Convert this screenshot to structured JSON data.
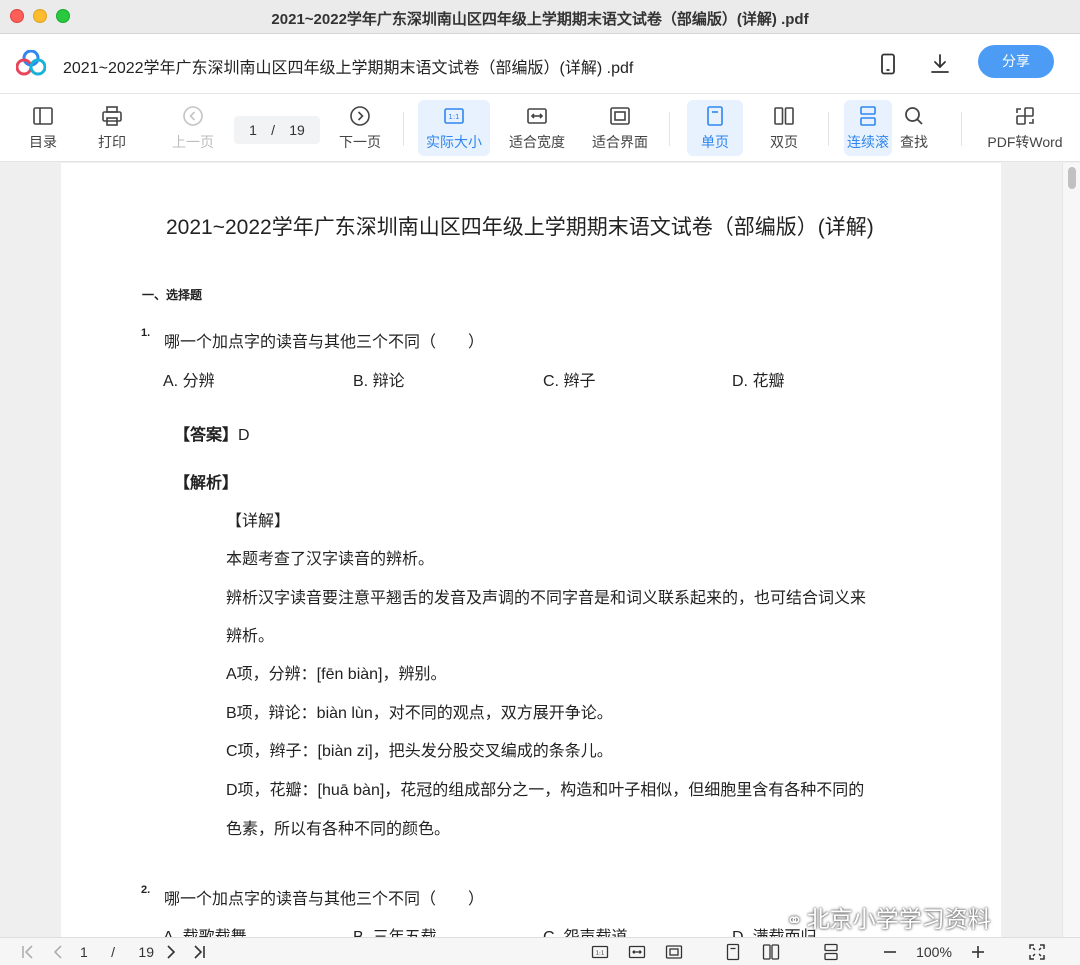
{
  "window": {
    "title": "2021~2022学年广东深圳南山区四年级上学期期末语文试卷（部编版）(详解) .pdf"
  },
  "appbar": {
    "doc_title": "2021~2022学年广东深圳南山区四年级上学期期末语文试卷（部编版）(详解) .pdf",
    "share_label": "分享",
    "icons": [
      "logo-icon",
      "phone-icon",
      "download-icon"
    ]
  },
  "toolbar": {
    "toc": "目录",
    "print": "打印",
    "prev": "上一页",
    "page_current": "1",
    "page_sep": "/",
    "page_total": "19",
    "next": "下一页",
    "actual_size": "实际大小",
    "fit_width": "适合宽度",
    "fit_page": "适合界面",
    "single": "单页",
    "double": "双页",
    "continuous": "连续滚",
    "find": "查找",
    "pdf_to_word": "PDF转Word",
    "accent_color": "#2f86ee"
  },
  "document": {
    "title": "2021~2022学年广东深圳南山区四年级上学期期末语文试卷（部编版）(详解)",
    "section": "一、选择题",
    "q1": {
      "num": "1.",
      "text": "哪一个加点字的读音与其他三个不同（　　）",
      "options": [
        "A. 分辨",
        "B. 辩论",
        "C. 辫子",
        "D. 花瓣"
      ],
      "answer_label": "【答案】",
      "answer": "D",
      "analysis_label": "【解析】",
      "detail_label": "【详解】",
      "lines": [
        "本题考查了汉字读音的辨析。",
        "辨析汉字读音要注意平翘舌的发音及声调的不同字音是和词义联系起来的，也可结合词义来",
        "辨析。",
        "A项，分辨：[fēn biàn]，辨别。",
        "B项，辩论：biàn lùn，对不同的观点，双方展开争论。",
        "C项，辫子：[biàn zi]，把头发分股交叉编成的条条儿。",
        "D项，花瓣：[huā bàn]，花冠的组成部分之一，构造和叶子相似，但细胞里含有各种不同的",
        "色素，所以有各种不同的颜色。"
      ]
    },
    "q2": {
      "num": "2.",
      "text": "哪一个加点字的读音与其他三个不同（　　）",
      "options": [
        "A. 载歌载舞",
        "B. 三年五载",
        "C. 怨声载道",
        "D. 满载而归"
      ]
    }
  },
  "watermark": "北京小学学习资料",
  "statusbar": {
    "page_current": "1",
    "page_sep": "/",
    "page_total": "19",
    "zoom": "100%"
  }
}
